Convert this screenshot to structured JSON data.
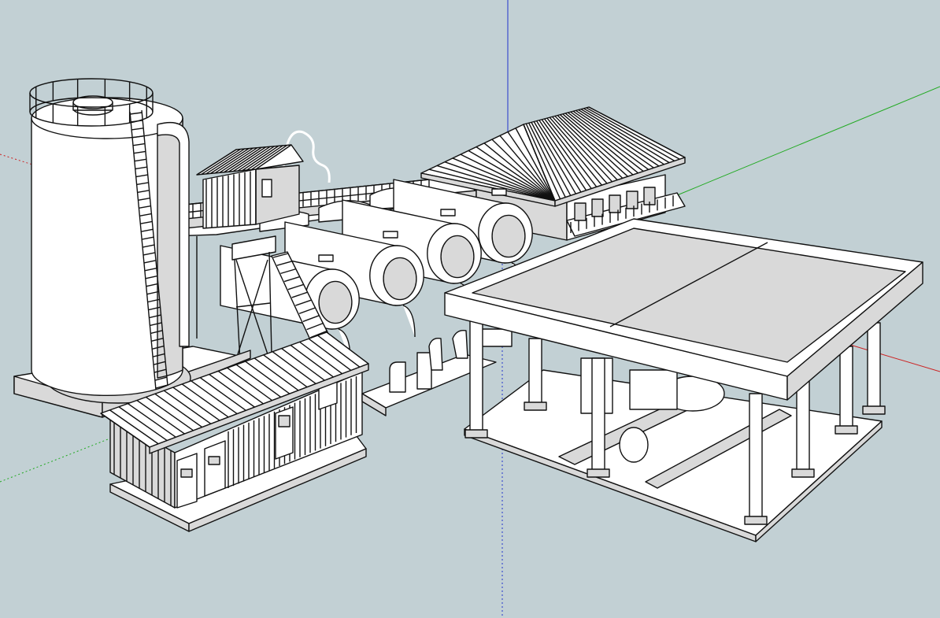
{
  "viewport": {
    "background": "#c2d0d4",
    "model_fill": "#ffffff",
    "model_shade": "#d9d9d9",
    "model_dark": "#a9a9a9",
    "edge_color": "#111111"
  },
  "axes": {
    "red_color": "#cc2222",
    "green_color": "#22aa22",
    "blue_color": "#2233cc"
  },
  "scene": {
    "objects": [
      "water-tower",
      "storage-tank-row",
      "pump-house",
      "office-building",
      "catwalk",
      "small-shed",
      "fuel-canopy"
    ]
  }
}
